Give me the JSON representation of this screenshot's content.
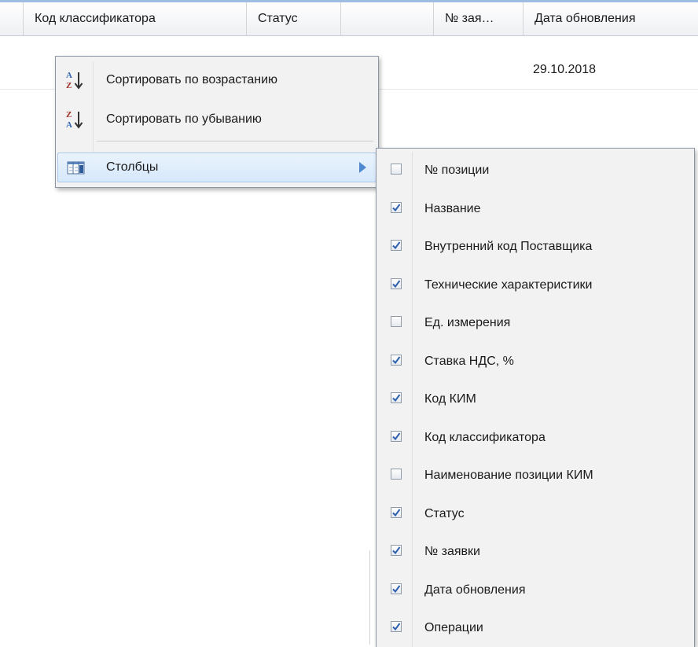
{
  "grid": {
    "columns": [
      {
        "label": "Код классификатора"
      },
      {
        "label": "Статус"
      },
      {
        "label": ""
      },
      {
        "label": "№ зая…"
      },
      {
        "label": "Дата обновления"
      }
    ],
    "rows": [
      {
        "date": "29.10.2018"
      }
    ]
  },
  "menu": {
    "sort_asc": {
      "label": "Сортировать по возрастанию",
      "icon": "sort-ascending-icon"
    },
    "sort_desc": {
      "label": "Сортировать по убыванию",
      "icon": "sort-descending-icon"
    },
    "columns": {
      "label": "Столбцы",
      "icon": "columns-icon"
    }
  },
  "columns_menu": {
    "items": [
      {
        "label": "№ позиции",
        "checked": false
      },
      {
        "label": "Название",
        "checked": true
      },
      {
        "label": "Внутренний код Поставщика",
        "checked": true
      },
      {
        "label": "Технические характеристики",
        "checked": true
      },
      {
        "label": "Ед. измерения",
        "checked": false
      },
      {
        "label": "Ставка НДС, %",
        "checked": true
      },
      {
        "label": "Код КИМ",
        "checked": true
      },
      {
        "label": "Код классификатора",
        "checked": true
      },
      {
        "label": "Наименование позиции КИМ",
        "checked": false
      },
      {
        "label": "Статус",
        "checked": true
      },
      {
        "label": "№ заявки",
        "checked": true
      },
      {
        "label": "Дата обновления",
        "checked": true
      },
      {
        "label": "Операции",
        "checked": true
      }
    ]
  },
  "colors": {
    "menu_background": "#f2f2f2",
    "active_item": "#dde9f8",
    "checkmark": "#2d5fb0",
    "submenu_arrow": "#4f88d0"
  }
}
